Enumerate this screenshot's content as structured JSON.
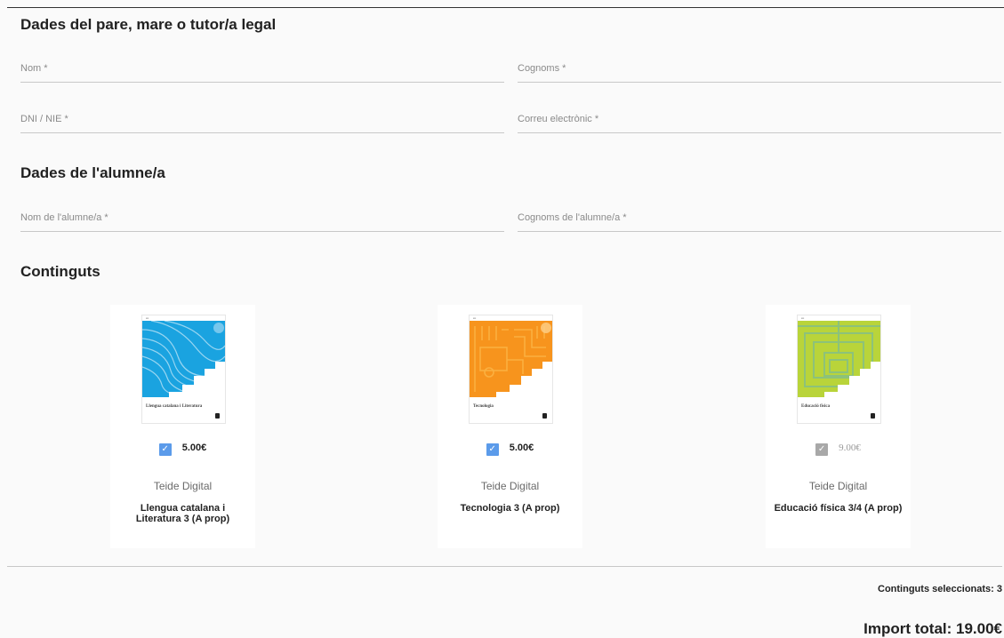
{
  "parent_section": {
    "title": "Dades del pare, mare o tutor/a legal",
    "fields": {
      "name": {
        "placeholder": "Nom *",
        "value": ""
      },
      "surname": {
        "placeholder": "Cognoms *",
        "value": ""
      },
      "dni": {
        "placeholder": "DNI / NIE *",
        "value": ""
      },
      "email": {
        "placeholder": "Correu electrònic *",
        "value": ""
      }
    }
  },
  "student_section": {
    "title": "Dades de l'alumne/a",
    "fields": {
      "name": {
        "placeholder": "Nom de l'alumne/a *",
        "value": ""
      },
      "surname": {
        "placeholder": "Cognoms de l'alumne/a *",
        "value": ""
      }
    }
  },
  "contents_section": {
    "title": "Continguts",
    "books": [
      {
        "price": "5.00€",
        "checked": true,
        "disabled": false,
        "publisher": "Teide Digital",
        "title": "Llengua catalana i Literatura 3 (A prop)",
        "cover_title": "Llengua catalana i Literatura",
        "cover_color": "#1aa3e0"
      },
      {
        "price": "5.00€",
        "checked": true,
        "disabled": false,
        "publisher": "Teide Digital",
        "title": "Tecnologia 3 (A prop)",
        "cover_title": "Tecnologia",
        "cover_color": "#f7941d"
      },
      {
        "price": "9.00€",
        "checked": true,
        "disabled": true,
        "publisher": "Teide Digital",
        "title": "Educació física 3/4 (A prop)",
        "cover_title": "Educació física",
        "cover_color": "#b9d43a"
      }
    ]
  },
  "summary": {
    "selected_count": "Continguts seleccionats: 3",
    "total": "Import total: 19.00€"
  },
  "colors": {
    "checkbox_active": "#5b9bea",
    "checkbox_disabled": "#a8a8a8",
    "divider": "#c8c8c8"
  }
}
